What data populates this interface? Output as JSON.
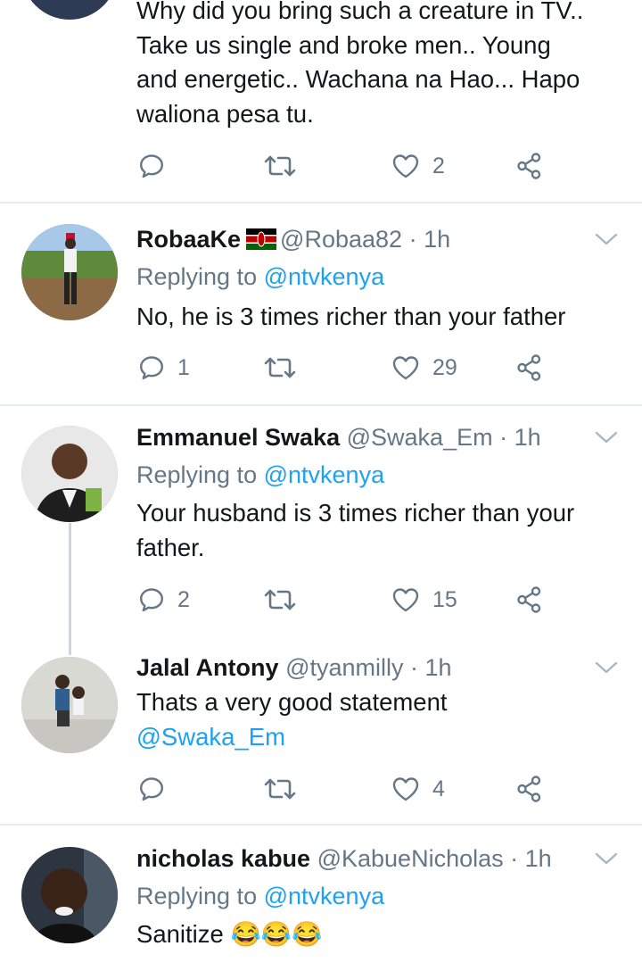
{
  "tweets": [
    {
      "id": "top",
      "text_lines": [
        "Why did you bring such a creature in TV..",
        "Take us single and broke men.. Young",
        "and energetic.. Wachana na Hao... Hapo",
        "waliona pesa tu."
      ],
      "replies": "",
      "retweets": "",
      "likes": "2"
    },
    {
      "id": "robaa",
      "name": "RobaaKe",
      "flag": "kenya-flag-emoji",
      "handle": "@Robaa82",
      "dot": "·",
      "time": "1h",
      "replying_prefix": "Replying to",
      "replying_to": "@ntvkenya",
      "text": "No, he is 3 times richer than your father",
      "replies": "1",
      "retweets": "",
      "likes": "29"
    },
    {
      "id": "swaka",
      "name": "Emmanuel Swaka",
      "handle": "@Swaka_Em",
      "dot": "·",
      "time": "1h",
      "replying_prefix": "Replying to",
      "replying_to": "@ntvkenya",
      "text": "Your husband is 3 times richer than your father.",
      "replies": "2",
      "retweets": "",
      "likes": "15"
    },
    {
      "id": "jalal",
      "name": "Jalal Antony",
      "handle": "@tyanmilly",
      "dot": "·",
      "time": "1h",
      "text": "Thats a very good statement",
      "mention": "@Swaka_Em",
      "replies": "",
      "retweets": "",
      "likes": "4"
    },
    {
      "id": "nicholas",
      "name": "nicholas kabue",
      "handle": "@KabueNicholas",
      "dot": "·",
      "time": "1h",
      "replying_prefix": "Replying to",
      "replying_to": "@ntvkenya",
      "text": "Sanitize",
      "emoji": "😂😂😂"
    }
  ],
  "icons": {
    "reply": "reply-icon",
    "retweet": "retweet-icon",
    "like": "like-icon",
    "share": "share-icon",
    "more": "chevron-down-icon"
  },
  "colors": {
    "text": "#14171a",
    "secondary": "#657786",
    "link": "#1da1f2",
    "divider": "#e6ecf0"
  }
}
